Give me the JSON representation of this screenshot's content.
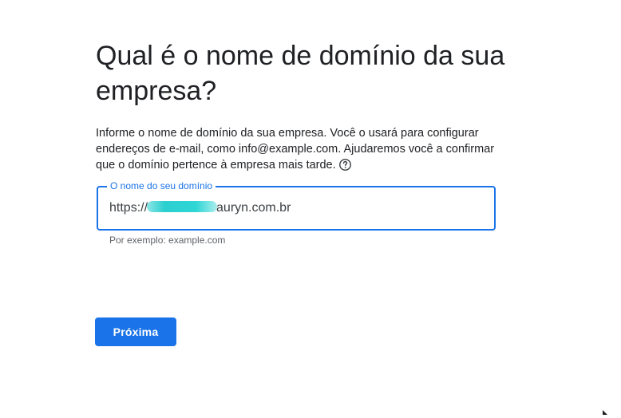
{
  "heading": {
    "title": "Qual é o nome de domínio da sua empresa?"
  },
  "description": {
    "text": "Informe o nome de domínio da sua empresa. Você o usará para configurar endereços de e-mail, como info@example.com. Ajudaremos você a confirmar que o domínio pertence à empresa mais tarde.",
    "help_icon": "help-circle-icon"
  },
  "domain_field": {
    "label": "O nome do seu domínio",
    "value_prefix": "https://",
    "value_suffix": "auryn.com.br",
    "hint": "Por exemplo: example.com"
  },
  "actions": {
    "next_label": "Próxima"
  },
  "colors": {
    "accent": "#1a73e8",
    "text": "#202124",
    "hint": "#5f6368",
    "redaction": "#2fd6d6"
  }
}
